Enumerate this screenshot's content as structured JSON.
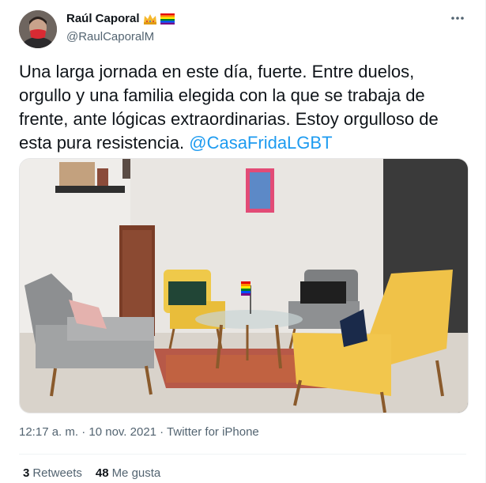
{
  "author": {
    "name": "Raúl Caporal",
    "handle": "@RaulCaporalM",
    "badges": [
      "crown-emoji-icon",
      "rainbow-flag-icon"
    ]
  },
  "tweet": {
    "text": "Una larga jornada en este día, fuerte. Entre duelos, orgullo y una familia elegida con la que se trabaja de frente, ante lógicas extraordinarias. Estoy orgulloso de esta pura resistencia.",
    "mention": "@CasaFridaLGBT",
    "timestamp": "12:17 a. m. · 10 nov. 2021 · Twitter for iPhone"
  },
  "stats": {
    "retweets_count": "3",
    "retweets_label": "Retweets",
    "likes_count": "48",
    "likes_label": "Me gusta"
  },
  "colors": {
    "accent": "#1d9bf0",
    "muted": "#536471",
    "text": "#0f1419"
  }
}
